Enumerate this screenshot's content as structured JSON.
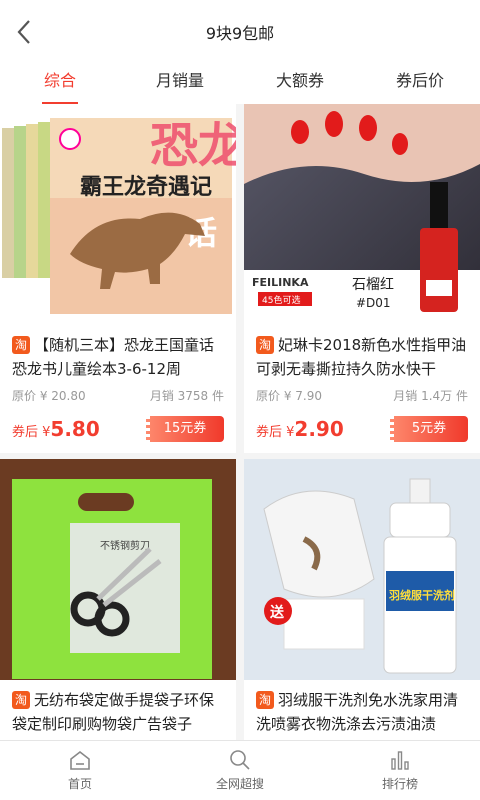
{
  "header": {
    "title": "9块9包邮"
  },
  "tabs": [
    {
      "label": "综合",
      "active": true
    },
    {
      "label": "月销量",
      "active": false
    },
    {
      "label": "大额券",
      "active": false
    },
    {
      "label": "券后价",
      "active": false
    }
  ],
  "colors": {
    "accent": "#f23d2f",
    "taobao": "#f25a1d"
  },
  "products": [
    {
      "tag": "淘",
      "name": "【随机三本】恐龙王国童话 恐龙书儿童绘本3-6-12周",
      "original_price": "原价 ¥ 20.80",
      "sales": "月销 3758 件",
      "price_prefix": "券后 ¥",
      "price": "5.80",
      "coupon": "15元券",
      "image": {
        "book_title": "霸王龙奇遇记",
        "side_text": "恐龙",
        "side_text2": "话"
      }
    },
    {
      "tag": "淘",
      "name": "妃琳卡2018新色水性指甲油可剥无毒撕拉持久防水快干",
      "original_price": "原价 ¥ 7.90",
      "sales": "月销 1.4万 件",
      "price_prefix": "券后 ¥",
      "price": "2.90",
      "coupon": "5元券",
      "image": {
        "brand": "FEILINKA",
        "brand_sub": "45色可选",
        "color_name": "石榴红",
        "color_code": "#D01"
      }
    },
    {
      "tag": "淘",
      "name": "无纺布袋定做手提袋子环保袋定制印刷购物袋广告袋子",
      "image": {
        "scissors_label": "不锈钢剪刀"
      }
    },
    {
      "tag": "淘",
      "name": "羽绒服干洗剂免水洗家用清洗喷雾衣物洗涤去污渍油渍",
      "image": {
        "badge": "送",
        "bottle_text": "羽绒服干洗剂"
      }
    }
  ],
  "tabbar": [
    {
      "label": "首页",
      "icon": "home-icon"
    },
    {
      "label": "全网超搜",
      "icon": "search-icon"
    },
    {
      "label": "排行榜",
      "icon": "ranking-icon"
    }
  ]
}
